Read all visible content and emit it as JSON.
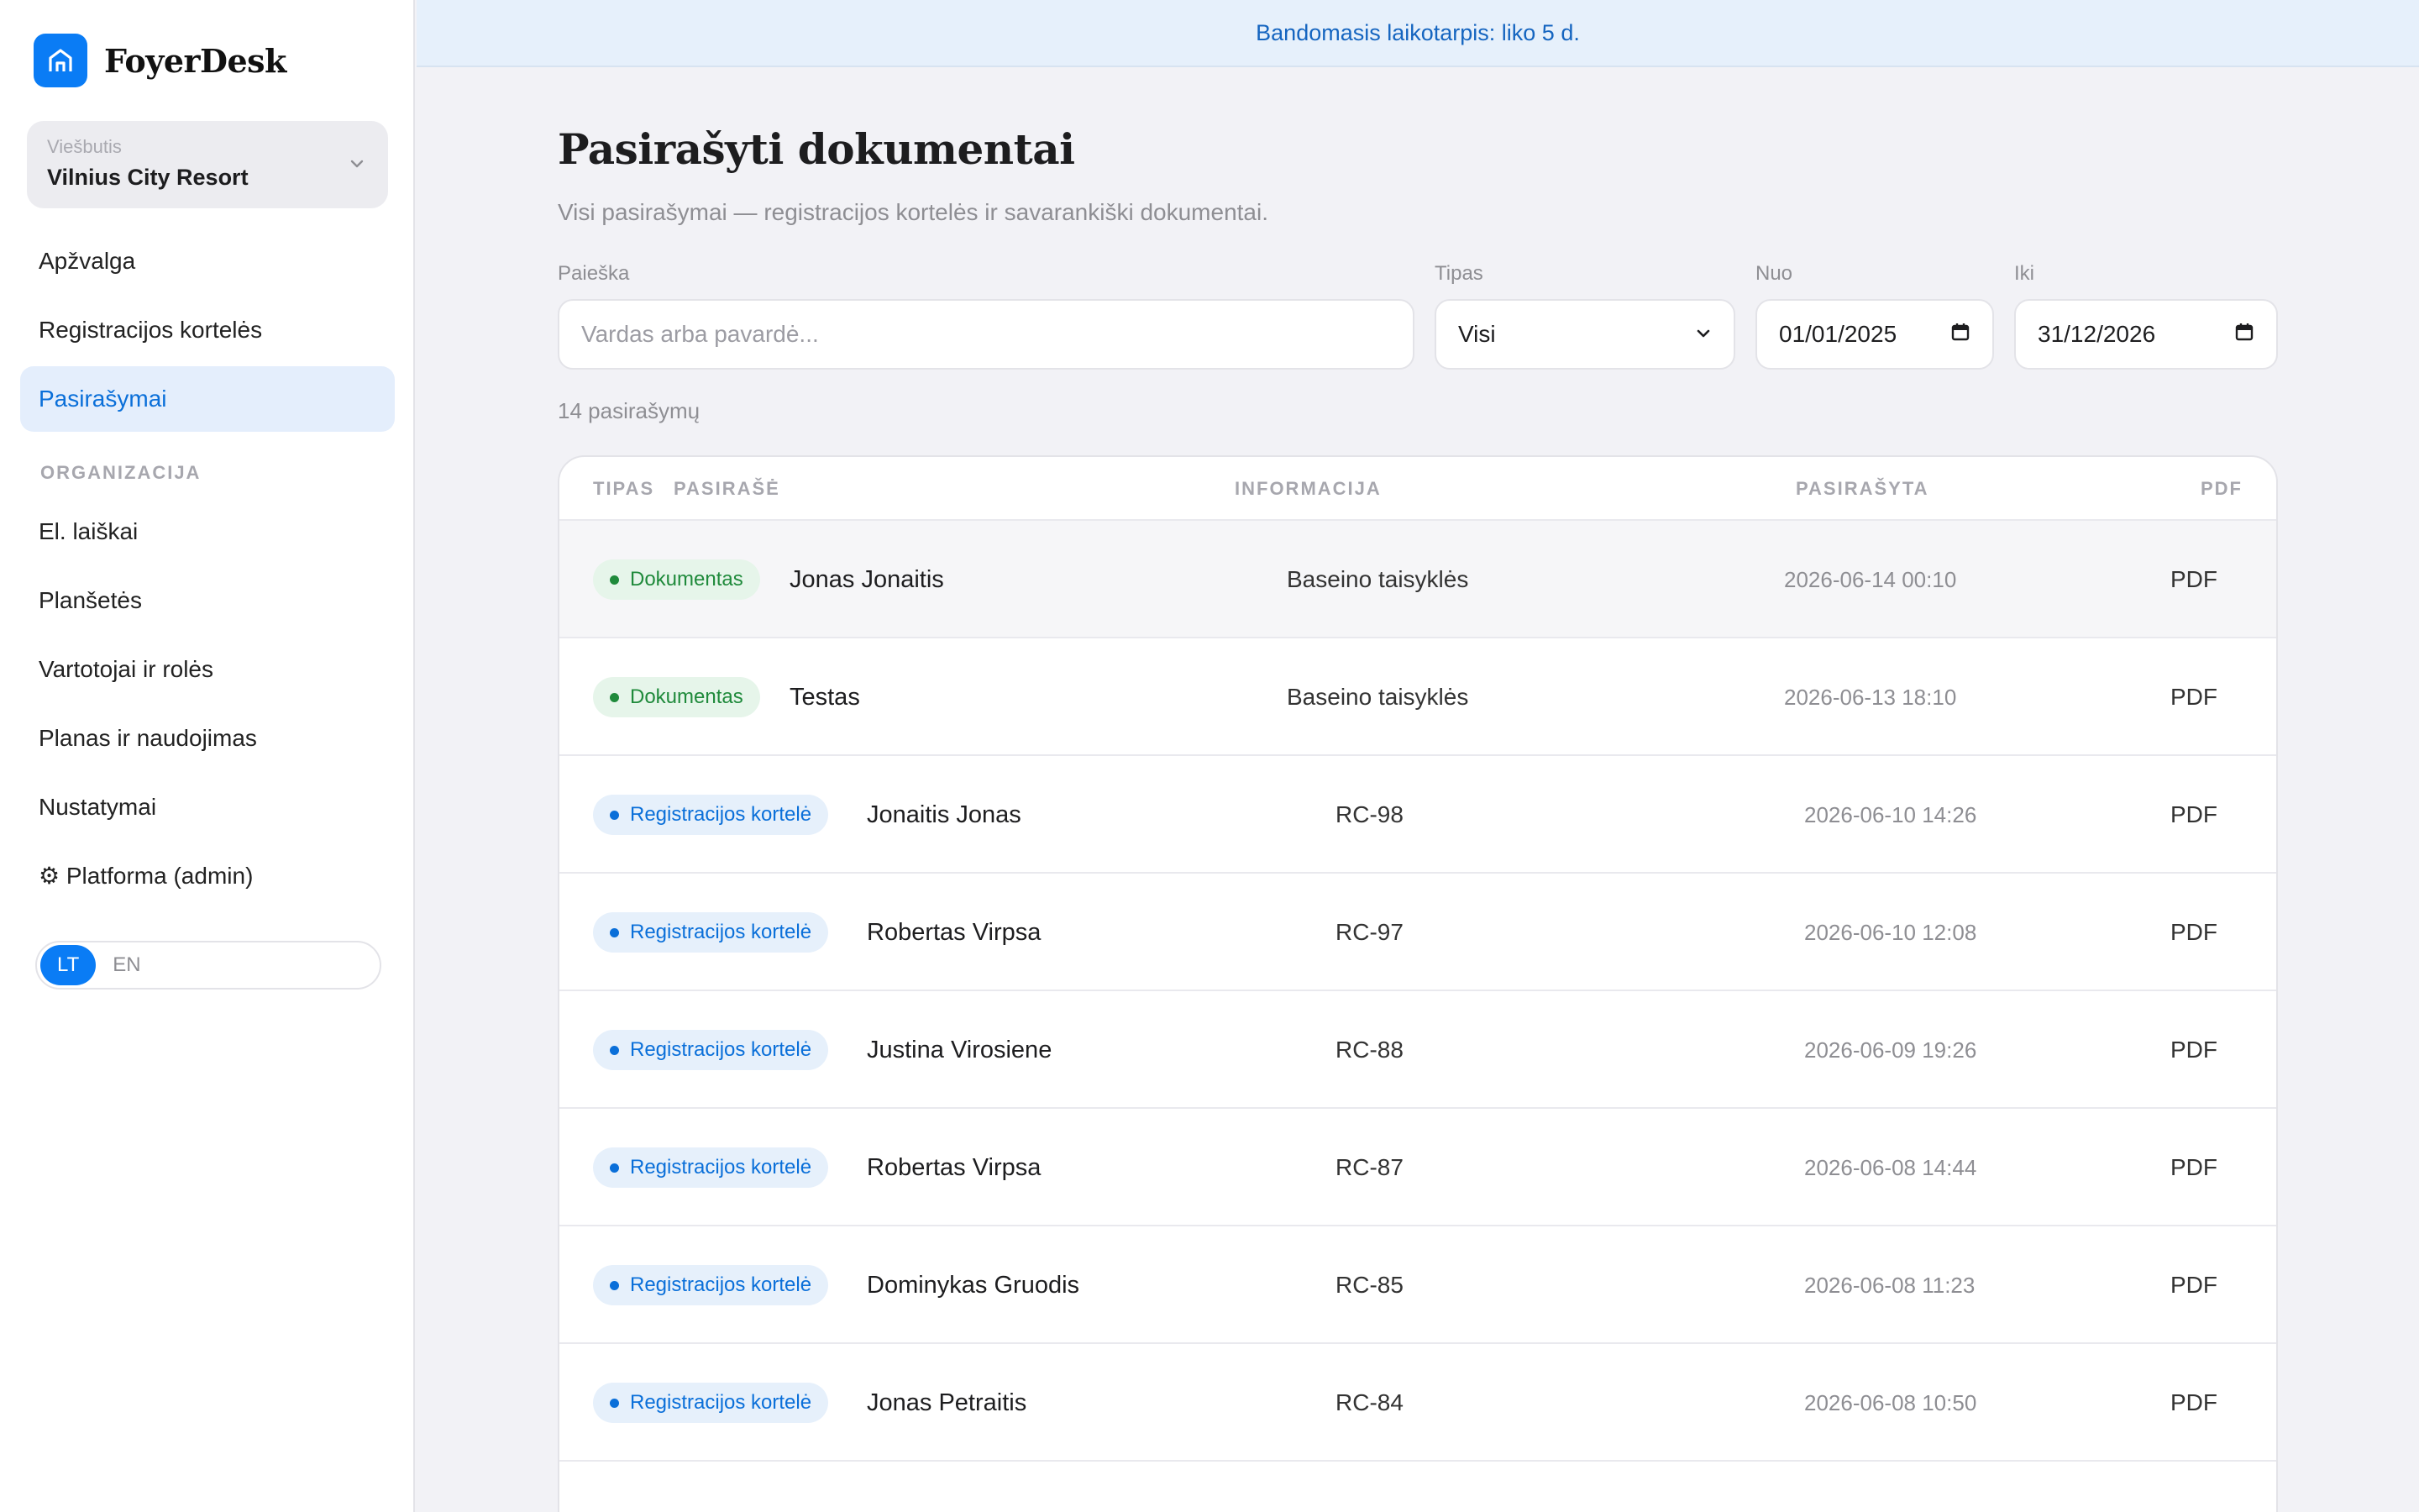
{
  "app": {
    "name": "FoyerDesk",
    "logo_icon": "hotel-door-icon",
    "accent": "#0a7cf5"
  },
  "hotel": {
    "caption": "Viešbutis",
    "name": "Vilnius City Resort"
  },
  "nav": {
    "items": [
      {
        "label": "Apžvalga"
      },
      {
        "label": "Registracijos kortelės"
      },
      {
        "label": "Pasirašymai",
        "active": true
      }
    ],
    "section_label": "ORGANIZACIJA",
    "org_items": [
      {
        "label": "El. laiškai"
      },
      {
        "label": "Planšetės"
      },
      {
        "label": "Vartotojai ir rolės"
      },
      {
        "label": "Planas ir naudojimas"
      },
      {
        "label": "Nustatymai"
      },
      {
        "label": "⚙ Platforma (admin)"
      }
    ]
  },
  "language": {
    "options": [
      "LT",
      "EN"
    ],
    "selected": "LT"
  },
  "banner": {
    "text": "Bandomasis laikotarpis: liko 5 d."
  },
  "page": {
    "title": "Pasirašyti dokumentai",
    "subtitle": "Visi pasirašymai — registracijos kortelės ir savarankiški dokumentai."
  },
  "filters": {
    "search": {
      "label": "Paieška",
      "placeholder": "Vardas arba pavardė..."
    },
    "type": {
      "label": "Tipas",
      "value": "Visi"
    },
    "from": {
      "label": "Nuo",
      "value": "01/01/2025"
    },
    "to": {
      "label": "Iki",
      "value": "31/12/2026"
    }
  },
  "count_text": "14 pasirašymų",
  "table": {
    "headers": {
      "type": "TIPAS",
      "signer": "PASIRAŠĖ",
      "info": "INFORMACIJA",
      "signed": "PASIRAŠYTA",
      "pdf": "PDF"
    },
    "rows": [
      {
        "kind": "doc",
        "type": "Dokumentas",
        "name": "Jonas Jonaitis",
        "info": "Baseino taisyklės",
        "date": "2026-06-14 00:10",
        "pdf": "PDF"
      },
      {
        "kind": "doc",
        "type": "Dokumentas",
        "name": "Testas",
        "info": "Baseino taisyklės",
        "date": "2026-06-13 18:10",
        "pdf": "PDF"
      },
      {
        "kind": "reg",
        "type": "Registracijos kortelė",
        "name": "Jonaitis Jonas",
        "info": "RC-98",
        "date": "2026-06-10 14:26",
        "pdf": "PDF"
      },
      {
        "kind": "reg",
        "type": "Registracijos kortelė",
        "name": "Robertas Virpsa",
        "info": "RC-97",
        "date": "2026-06-10 12:08",
        "pdf": "PDF"
      },
      {
        "kind": "reg",
        "type": "Registracijos kortelė",
        "name": "Justina Virosiene",
        "info": "RC-88",
        "date": "2026-06-09 19:26",
        "pdf": "PDF"
      },
      {
        "kind": "reg",
        "type": "Registracijos kortelė",
        "name": "Robertas Virpsa",
        "info": "RC-87",
        "date": "2026-06-08 14:44",
        "pdf": "PDF"
      },
      {
        "kind": "reg",
        "type": "Registracijos kortelė",
        "name": "Dominykas Gruodis",
        "info": "RC-85",
        "date": "2026-06-08 11:23",
        "pdf": "PDF"
      },
      {
        "kind": "reg",
        "type": "Registracijos kortelė",
        "name": "Jonas Petraitis",
        "info": "RC-84",
        "date": "2026-06-08 10:50",
        "pdf": "PDF"
      }
    ]
  },
  "colors": {
    "document_badge": "#1f8a3b",
    "registration_badge": "#0a6fd9",
    "banner_text": "#1565c0"
  }
}
